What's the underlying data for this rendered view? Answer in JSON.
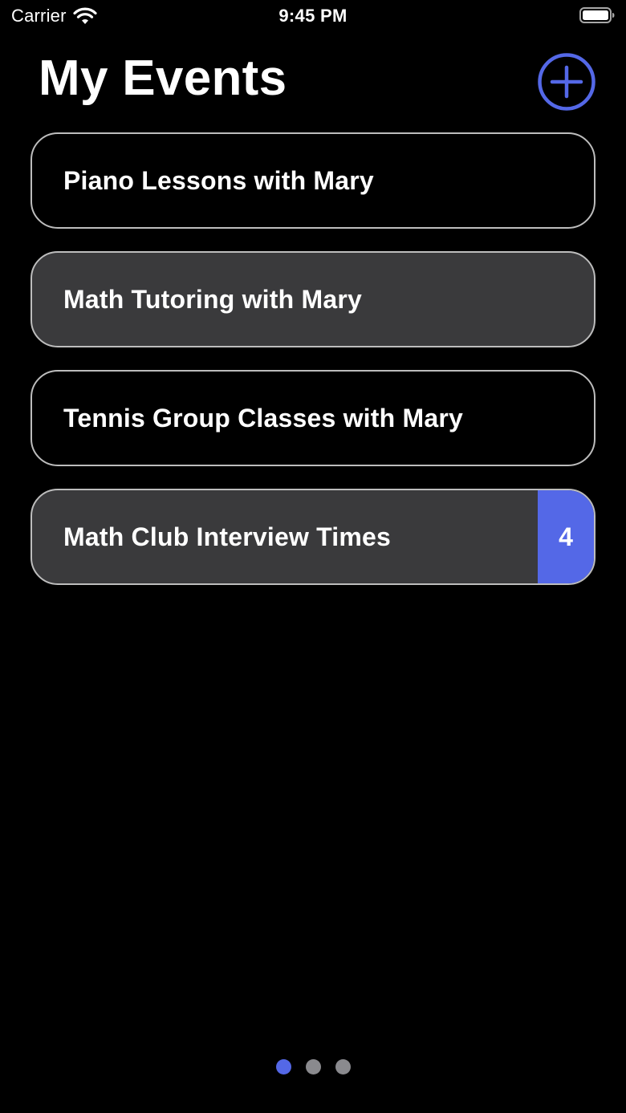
{
  "status_bar": {
    "carrier": "Carrier",
    "time": "9:45 PM",
    "icons": [
      "wifi-icon",
      "battery-icon"
    ]
  },
  "header": {
    "title": "My Events",
    "add_button_icon": "plus-circle-icon"
  },
  "events": [
    {
      "title": "Piano Lessons with Mary",
      "style": "empty",
      "badge": null
    },
    {
      "title": "Math Tutoring with Mary",
      "style": "filled",
      "badge": null
    },
    {
      "title": "Tennis Group Classes with Mary",
      "style": "empty",
      "badge": null
    },
    {
      "title": "Math Club Interview Times",
      "style": "filled",
      "badge": "4"
    }
  ],
  "page_indicator": {
    "count": 3,
    "active_index": 0
  },
  "colors": {
    "background": "#000000",
    "accent": "#5468e7",
    "card_fill": "#3a3a3c",
    "card_border": "#bdbdbd",
    "inactive_dot": "#8a8a8e",
    "text": "#ffffff"
  }
}
